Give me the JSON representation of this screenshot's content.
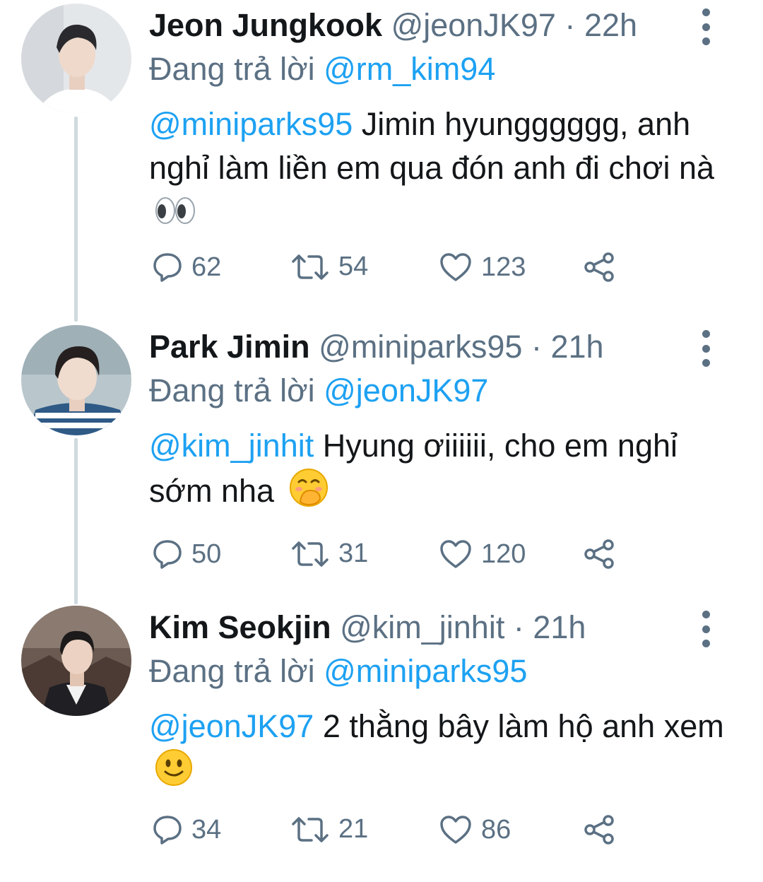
{
  "tweets": [
    {
      "name": "Jeon Jungkook",
      "handle": "@jeonJK97",
      "separator": "·",
      "time": "22h",
      "replying_prefix": "Đang trả lời",
      "replying_to": "@rm_kim94",
      "mention": "@miniparks95",
      "text": "Jimin hyungggggg, anh nghỉ làm liền em qua đón anh đi chơi nà",
      "emoji": "eyes-emoji",
      "replies": "62",
      "retweets": "54",
      "likes": "123"
    },
    {
      "name": "Park Jimin",
      "handle": "@miniparks95",
      "separator": "·",
      "time": "21h",
      "replying_prefix": "Đang trả lời",
      "replying_to": "@jeonJK97",
      "mention": "@kim_jinhit",
      "text": "Hyung ơiiiiii, cho em nghỉ sớm nha",
      "emoji": "hand-over-mouth-emoji",
      "replies": "50",
      "retweets": "31",
      "likes": "120"
    },
    {
      "name": "Kim Seokjin",
      "handle": "@kim_jinhit",
      "separator": "·",
      "time": "21h",
      "replying_prefix": "Đang trả lời",
      "replying_to": "@miniparks95",
      "mention": "@jeonJK97",
      "text": "2 thằng bây làm hộ anh xem",
      "emoji": "slightly-smiling-emoji",
      "replies": "34",
      "retweets": "21",
      "likes": "86"
    }
  ],
  "colors": {
    "link": "#1da1f2",
    "secondary": "#5b7083",
    "primary": "#14171a",
    "thread_line": "#cfd9de"
  },
  "icons": [
    "reply-icon",
    "retweet-icon",
    "like-icon",
    "share-icon",
    "more-icon"
  ]
}
